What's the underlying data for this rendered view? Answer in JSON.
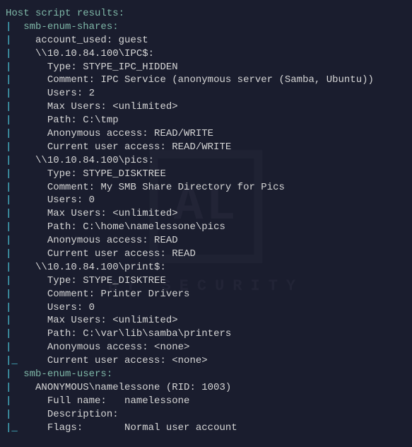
{
  "title": "Host script results:",
  "sections": {
    "smb_enum_shares": {
      "label": "smb-enum-shares:",
      "account_used_label": "account_used:",
      "account_used_value": "guest",
      "shares": [
        {
          "name": "\\\\10.10.84.100\\IPC$:",
          "attrs": {
            "type_label": "Type:",
            "type_value": "STYPE_IPC_HIDDEN",
            "comment_label": "Comment:",
            "comment_value": "IPC Service (anonymous server (Samba, Ubuntu))",
            "users_label": "Users:",
            "users_value": "2",
            "maxusers_label": "Max Users:",
            "maxusers_value": "<unlimited>",
            "path_label": "Path:",
            "path_value": "C:\\tmp",
            "anon_label": "Anonymous access:",
            "anon_value": "READ/WRITE",
            "curr_label": "Current user access:",
            "curr_value": "READ/WRITE"
          }
        },
        {
          "name": "\\\\10.10.84.100\\pics:",
          "attrs": {
            "type_label": "Type:",
            "type_value": "STYPE_DISKTREE",
            "comment_label": "Comment:",
            "comment_value": "My SMB Share Directory for Pics",
            "users_label": "Users:",
            "users_value": "0",
            "maxusers_label": "Max Users:",
            "maxusers_value": "<unlimited>",
            "path_label": "Path:",
            "path_value": "C:\\home\\namelessone\\pics",
            "anon_label": "Anonymous access:",
            "anon_value": "READ",
            "curr_label": "Current user access:",
            "curr_value": "READ"
          }
        },
        {
          "name": "\\\\10.10.84.100\\print$:",
          "attrs": {
            "type_label": "Type:",
            "type_value": "STYPE_DISKTREE",
            "comment_label": "Comment:",
            "comment_value": "Printer Drivers",
            "users_label": "Users:",
            "users_value": "0",
            "maxusers_label": "Max Users:",
            "maxusers_value": "<unlimited>",
            "path_label": "Path:",
            "path_value": "C:\\var\\lib\\samba\\printers",
            "anon_label": "Anonymous access:",
            "anon_value": "<none>",
            "curr_label": "Current user access:",
            "curr_value": "<none>"
          }
        }
      ]
    },
    "smb_enum_users": {
      "label": "smb-enum-users:",
      "user_line": "ANONYMOUS\\namelessone (RID: 1003)",
      "fullname_label": "Full name:",
      "fullname_value": "namelessone",
      "desc_label": "Description:",
      "flags_label": "Flags:",
      "flags_value": "Normal user account"
    }
  },
  "watermark": {
    "big": "AL",
    "line": "BY           SECURITY"
  },
  "colors": {
    "bg": "#1a1d2e",
    "bar": "#4dd0e1",
    "sect": "#7fb8a8",
    "text": "#e8e8e8"
  }
}
